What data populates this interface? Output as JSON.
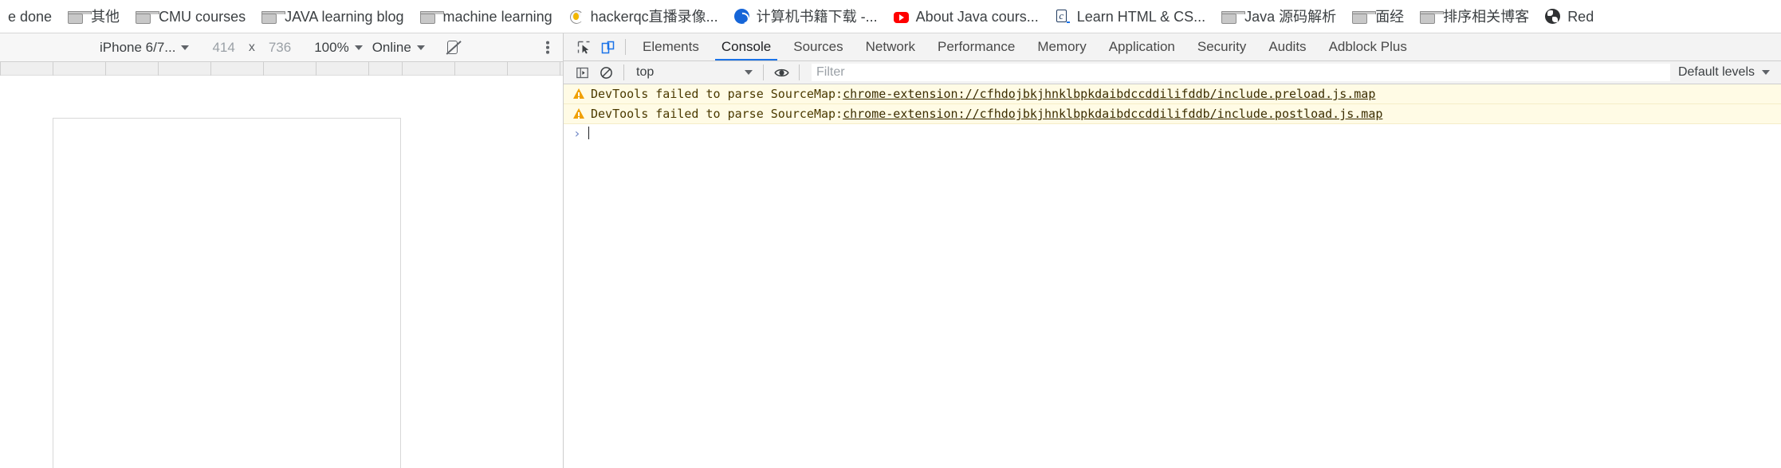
{
  "bookmarks_bar": {
    "items": [
      {
        "label": "e done",
        "icon": "none"
      },
      {
        "label": "其他",
        "icon": "folder-icon"
      },
      {
        "label": "CMU courses",
        "icon": "folder-icon"
      },
      {
        "label": "JAVA learning blog",
        "icon": "folder-icon"
      },
      {
        "label": "machine learning",
        "icon": "folder-icon"
      },
      {
        "label": "hackerqc直播录像...",
        "icon": "hackerqc-favicon"
      },
      {
        "label": "计算机书籍下载 -...",
        "icon": "blue-circle-favicon"
      },
      {
        "label": "About Java cours...",
        "icon": "youtube-favicon"
      },
      {
        "label": "Learn HTML & CS...",
        "icon": "codecademy-favicon"
      },
      {
        "label": "Java 源码解析",
        "icon": "folder-icon"
      },
      {
        "label": "面经",
        "icon": "folder-icon"
      },
      {
        "label": "排序相关博客",
        "icon": "folder-icon"
      },
      {
        "label": "Red",
        "icon": "globe-favicon"
      }
    ]
  },
  "device_toolbar": {
    "device": "iPhone 6/7...",
    "width": "414",
    "x_separator": "x",
    "height": "736",
    "zoom": "100%",
    "throttling": "Online",
    "rotate_icon": "rotate-icon",
    "more_options_icon": "more-vertical-icon"
  },
  "devtools": {
    "inspect_icon": "inspect-element-icon",
    "device_toggle_icon": "toggle-device-toolbar-icon",
    "tabs": [
      {
        "label": "Elements",
        "active": false
      },
      {
        "label": "Console",
        "active": true
      },
      {
        "label": "Sources",
        "active": false
      },
      {
        "label": "Network",
        "active": false
      },
      {
        "label": "Performance",
        "active": false
      },
      {
        "label": "Memory",
        "active": false
      },
      {
        "label": "Application",
        "active": false
      },
      {
        "label": "Security",
        "active": false
      },
      {
        "label": "Audits",
        "active": false
      },
      {
        "label": "Adblock Plus",
        "active": false
      }
    ]
  },
  "console_toolbar": {
    "sidebar_toggle_icon": "console-sidebar-icon",
    "clear_icon": "clear-console-icon",
    "context": "top",
    "eye_icon": "live-expression-icon",
    "filter_placeholder": "Filter",
    "filter_value": "",
    "levels": "Default levels"
  },
  "console": {
    "messages": [
      {
        "type": "warning",
        "icon": "warning-icon",
        "text": "DevTools failed to parse SourceMap: ",
        "link": "chrome-extension://cfhdojbkjhnklbpkdaibdccddilifddb/include.preload.js.map"
      },
      {
        "type": "warning",
        "icon": "warning-icon",
        "text": "DevTools failed to parse SourceMap: ",
        "link": "chrome-extension://cfhdojbkjhnklbpkdaibdccddilifddb/include.postload.js.map"
      }
    ],
    "prompt_symbol": "›"
  },
  "colors": {
    "accent_blue": "#1a73e8",
    "warning_bg": "#fffbe5",
    "warning_icon": "#f0a000",
    "toolbar_bg": "#f3f3f3",
    "text": "#3c4043"
  }
}
